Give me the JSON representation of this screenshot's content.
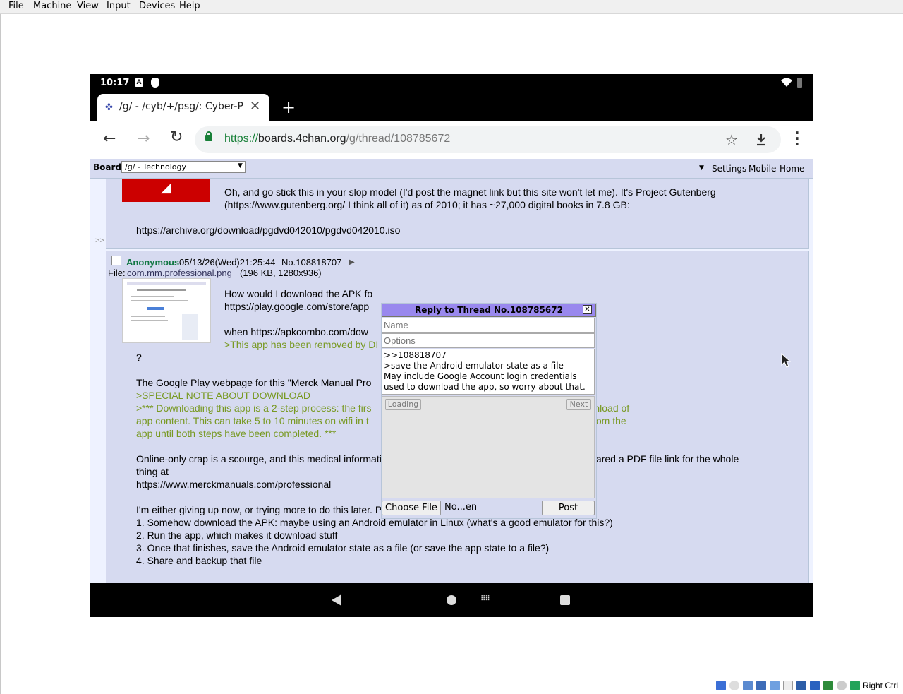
{
  "host_menu": [
    "File",
    "Machine",
    "View",
    "Input",
    "Devices",
    "Help"
  ],
  "statusbar": {
    "time": "10:17"
  },
  "tab": {
    "title": "/g/ - /cyb/+/psg/: Cyber-Pun"
  },
  "toolbar": {
    "url_scheme": "https://",
    "url_host": "boards.4chan.org",
    "url_path": "/g/thread/108785672"
  },
  "boardbar": {
    "label": "Board",
    "selected": "/g/ - Technology",
    "links": [
      "Settings",
      "Mobile",
      "Home"
    ]
  },
  "post1": {
    "line1": "Oh, and go stick this in your slop model (I'd post the magnet link but this site won't let me). It's Project Gutenberg",
    "line2": "(https://www.gutenberg.org/ I think all of it) as of 2010; it has ~27,000 digital books in 7.8 GB:",
    "link": "https://archive.org/download/pgdvd042010/pgdvd042010.iso"
  },
  "post2": {
    "name": "Anonymous",
    "datetime": "05/13/26(Wed)21:25:44",
    "number": "No.108818707",
    "file_label": "File:",
    "file_name": "com.mm.professional.png",
    "file_meta": "(196 KB, 1280x936)",
    "lines": [
      {
        "t": "How would I download the APK fo",
        "q": false
      },
      {
        "t": "https://play.google.com/store/app",
        "q": false
      },
      {
        "t": "",
        "q": false
      },
      {
        "t": "when https://apkcombo.com/dow",
        "q": false
      },
      {
        "t": ">This app has been removed by DI",
        "q": true
      }
    ],
    "body": [
      {
        "t": "?",
        "q": false
      },
      {
        "t": "",
        "q": false
      },
      {
        "t": "The Google Play webpage for this \"Merck Manual Pro",
        "q": false
      },
      {
        "t": ">SPECIAL NOTE ABOUT DOWNLOAD",
        "q": true
      },
      {
        "t": ">*** Downloading this app is a 2-step process: the firs                                     he second step is a full download of",
        "q": true
      },
      {
        "t": "app content. This can take 5 to 10 minutes on wifi in t                                    lease do not navigate away from the",
        "q": true
      },
      {
        "t": "app until both steps have been completed. ***",
        "q": true
      },
      {
        "t": "",
        "q": false
      },
      {
        "t": "Online-only crap is a scourge, and this medical information isn't archive-friendly. They should have just shared a PDF file link for the whole",
        "q": false
      },
      {
        "t": "thing at",
        "q": false
      },
      {
        "t": "https://www.merckmanuals.com/professional",
        "q": false
      },
      {
        "t": "",
        "q": false
      },
      {
        "t": "I'm either giving up now, or trying more to do this later. Plan:",
        "q": false
      },
      {
        "t": "1. Somehow download the APK: maybe using an Android emulator in Linux (what's a good emulator for this?)",
        "q": false
      },
      {
        "t": "2. Run the app, which makes it download stuff",
        "q": false
      },
      {
        "t": "3. Once that finishes, save the Android emulator state as a file (or save the app state to a file?)",
        "q": false
      },
      {
        "t": "4. Share and backup that file",
        "q": false
      }
    ]
  },
  "quick_reply": {
    "title": "Reply to Thread No.108785672",
    "name_placeholder": "Name",
    "options_placeholder": "Options",
    "comment": ">>108818707\n>save the Android emulator state as a file\nMay include Google Account login credentials\nused to download the app, so worry about that.",
    "captcha_loading": "Loading",
    "captcha_next": "Next",
    "choose_file": "Choose File",
    "file_status": "No...en",
    "post": "Post"
  },
  "tray": {
    "hostkey": "Right Ctrl"
  },
  "colors": {
    "accent_green": "#789922",
    "reply_bg": "#d6daf0",
    "page_bg": "#eef2ff",
    "qr_title": "#9988ee",
    "name_green": "#117743"
  }
}
